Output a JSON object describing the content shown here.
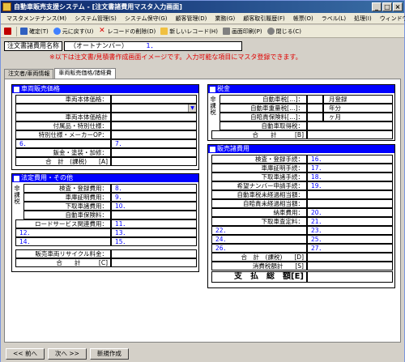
{
  "window": {
    "title": "自動車販売支援システム - [注文書諸費用マスタ入力画面]",
    "minimize": "_",
    "maximize": "□",
    "close": "×"
  },
  "menu": [
    "マスタメンテナンス(M)",
    "システム管理(S)",
    "システム保守(G)",
    "顧客管理(D)",
    "業務(G)",
    "顧客取引履歴(F)",
    "帳票(O)",
    "ラベル(L)",
    "処理(I)",
    "ウィンドウ(W)"
  ],
  "toolbar": {
    "confirm": "確定(T)",
    "undo": "元に戻す(U)",
    "delete": "レコードの削除(D)",
    "new_record": "新しいレコード(H)",
    "print": "画面印刷(P)",
    "close": "閉じる(C)"
  },
  "header": {
    "name_label": "注文書諸費用名称",
    "name_value": "（オートナンバー）",
    "name_num": "1．"
  },
  "notice": "※以下は注文書/見積書作成画面イメージです。入力可能な項目にマスタ登録できます。",
  "tabs": [
    "注文者/車両情報",
    "車両販売価格/諸経費"
  ],
  "left_sections": {
    "vehicle": {
      "title": "車両販売価格",
      "body_price": "車両本体価格：",
      "body_total": "車両本体価格計",
      "accessory": "付属品・特別仕様：",
      "special": "特別仕様・メーカーOP：",
      "n6": "6．",
      "n7": "7．",
      "paint": "鈑金・塗装・加修：",
      "total": "合　計　(課税)　　[A]"
    },
    "legal": {
      "title": "法定費用・その他",
      "nontax": "非課税",
      "inspect": "検査・登録費用：",
      "garage": "車庫証明費用：",
      "trade": "下取車諸費用：",
      "insurance": "自動車保険料：",
      "roadservice": "ロードサービス関連費用：",
      "n8": "8．",
      "n9": "9．",
      "n10": "10．",
      "n11": "11．",
      "n12": "12．",
      "n13": "13．",
      "n14": "14．",
      "n15": "15．",
      "recycle": "販売車両リサイクル料金：",
      "total": "合　　計　　　[C]"
    }
  },
  "right_sections": {
    "tax": {
      "title": "税金",
      "nontax": "非課税",
      "car_tax": "自動車税[…]：",
      "weight_tax": "自動車重量税[…]：",
      "liability": "自賠責保険料[…]：",
      "acquisition": "自動車取得税：",
      "registration_month": "月登録",
      "years": "年分",
      "months": "ヶ月",
      "total": "合　　計　　　[B]"
    },
    "sales": {
      "title": "販売諸費用",
      "inspect": "検査・登録手続：",
      "garage": "車庫証明手続：",
      "trade": "下取車諸手続：",
      "plate": "希望ナンバー申請手続：",
      "car_tax_equiv": "自動車税未経過相当額：",
      "liability_equiv": "自賠責未経過相当額：",
      "delivery": "納車費用：",
      "assessment": "下取車査定料：",
      "n16": "16．",
      "n17": "17．",
      "n18": "18．",
      "n19": "19．",
      "n20": "20．",
      "n21": "21．",
      "n22": "22．",
      "n23": "23．",
      "n24": "24．",
      "n25": "25．",
      "n26": "26．",
      "n27": "27．",
      "total": "合　計　(課税)　　[D]",
      "consumption": "消費税額計　　[S]",
      "payment": "支　払　総　額[E]"
    }
  },
  "bottom": {
    "prev": "<< 前へ",
    "next": "次へ >>",
    "new": "新規作成"
  }
}
